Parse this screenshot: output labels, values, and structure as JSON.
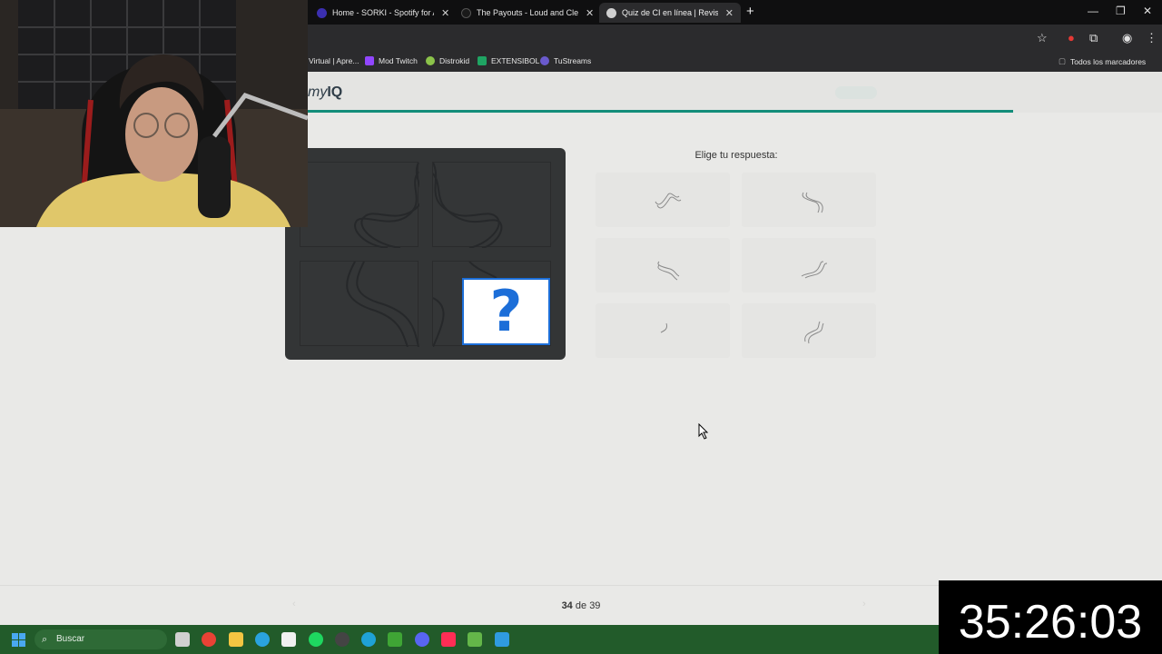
{
  "browser": {
    "tabs": [
      {
        "title": "Home - SORKI - Spotify for Art",
        "color": "#3b2fb0"
      },
      {
        "title": "The Payouts - Loud and Clear",
        "color": "#222"
      },
      {
        "title": "Quiz de CI en línea | Revisa tu p",
        "color": "#cfcfcf"
      }
    ],
    "new_tab": "+",
    "bookmarks": [
      {
        "label": "Virtual | Apre...",
        "color": "#9aa0a6"
      },
      {
        "label": "Mod Twitch",
        "color": "#9146ff"
      },
      {
        "label": "Distrokid",
        "color": "#8bc34a"
      },
      {
        "label": "EXTENSIBOL",
        "color": "#1fa463"
      },
      {
        "label": "TuStreams",
        "color": "#6a5acd"
      }
    ],
    "all_bookmarks": "Todos los marcadores"
  },
  "site": {
    "logo_italic": "my",
    "logo_bold": "IQ",
    "header_badge": "",
    "progress_percent": 87.2
  },
  "quiz": {
    "question_mark": "?",
    "answers_title": "Elige tu respuesta:",
    "answers": [
      "option-1",
      "option-2",
      "option-3",
      "option-4",
      "option-5",
      "option-6"
    ],
    "current": "34",
    "of_text": "de",
    "total": "39"
  },
  "taskbar": {
    "search_placeholder": "Buscar",
    "apps": [
      {
        "name": "task-view",
        "color": "#d0d0d0"
      },
      {
        "name": "chrome",
        "color": "#e94235"
      },
      {
        "name": "file-explorer",
        "color": "#f4c542"
      },
      {
        "name": "telegram",
        "color": "#2aa3df"
      },
      {
        "name": "capcut",
        "color": "#f0f0f0"
      },
      {
        "name": "spotify",
        "color": "#1ed760"
      },
      {
        "name": "obs",
        "color": "#444"
      },
      {
        "name": "edge",
        "color": "#1fa2d6"
      },
      {
        "name": "minecraft",
        "color": "#3fa535"
      },
      {
        "name": "discord",
        "color": "#5865f2"
      },
      {
        "name": "tiktok",
        "color": "#ff2d55"
      },
      {
        "name": "minecraft-launcher",
        "color": "#64b649"
      },
      {
        "name": "paint",
        "color": "#2f9be0"
      }
    ]
  },
  "overlay": {
    "timer": "35:26:03"
  }
}
